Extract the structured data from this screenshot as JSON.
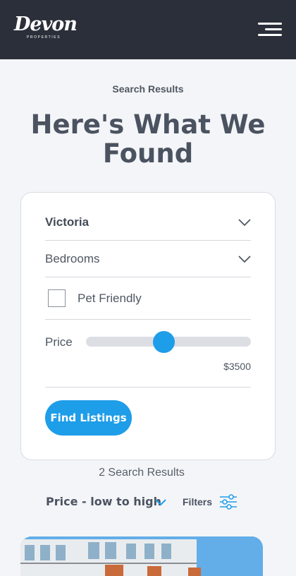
{
  "header": {
    "logo_text": "Devon",
    "logo_subtext": "PROPERTIES",
    "menu_icon": "hamburger-menu-icon"
  },
  "page": {
    "subtitle": "Search Results",
    "headline_line1": "Here's What We",
    "headline_line2": "Found"
  },
  "search": {
    "location_value": "Victoria",
    "bedrooms_placeholder": "Bedrooms",
    "pet_friendly_label": "Pet Friendly",
    "pet_friendly_checked": false,
    "price_label": "Price",
    "price_value": "$3500",
    "price_slider_fraction": 0.47,
    "submit_label": "Find Listings"
  },
  "results": {
    "count_text": "2 Search Results",
    "sort_label": "Price - low to high",
    "filters_label": "Filters"
  },
  "colors": {
    "header_bg": "#2b2f39",
    "accent": "#1e9de9",
    "text": "#4f5762",
    "page_bg": "#f4f5f8"
  }
}
